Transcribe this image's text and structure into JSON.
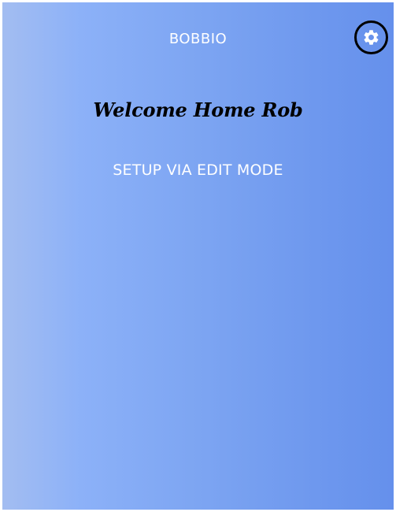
{
  "header": {
    "app_title": "BOBBIO",
    "settings_icon": "gear-icon"
  },
  "main": {
    "welcome": "Welcome Home Rob",
    "setup_message": "SETUP VIA EDIT MODE"
  },
  "colors": {
    "gradient_start": "#a3bdf1",
    "gradient_end": "#6590ec",
    "text_light": "#ffffff",
    "text_dark": "#000000"
  }
}
